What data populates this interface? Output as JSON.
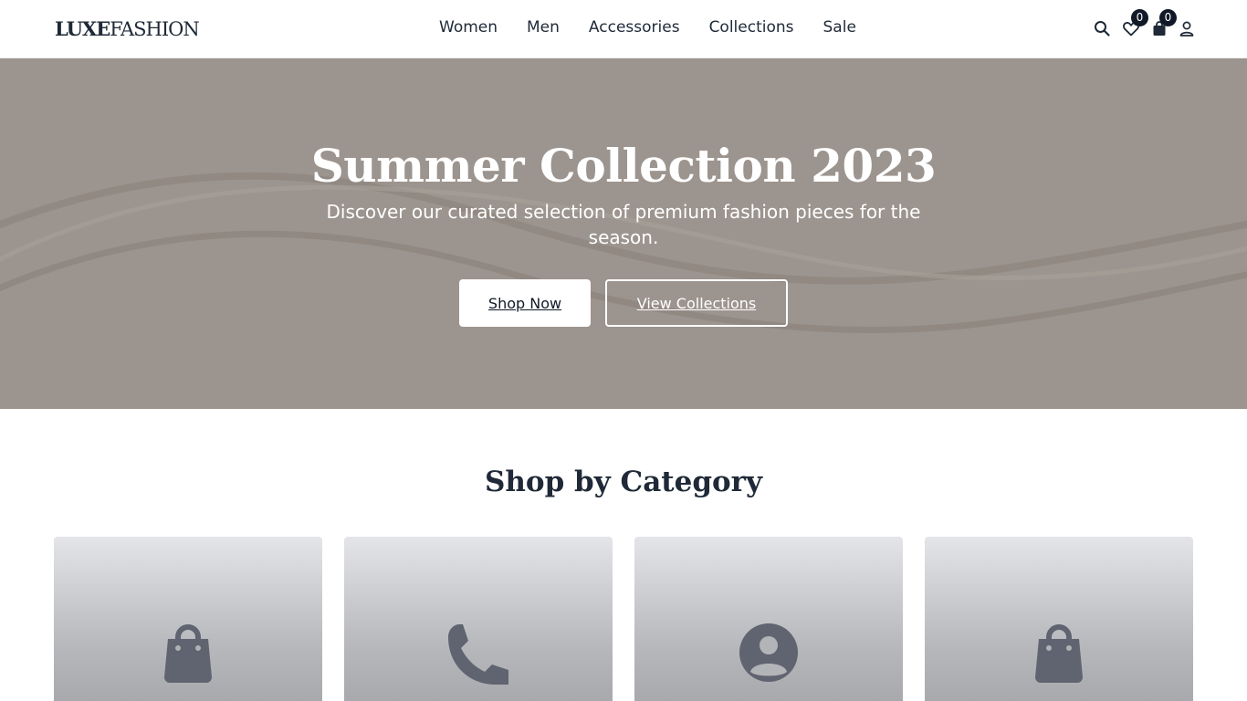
{
  "header": {
    "logo_part1": "LUXE",
    "logo_part2": "FASHION",
    "nav": [
      "Women",
      "Men",
      "Accessories",
      "Collections",
      "Sale"
    ],
    "icons": {
      "search": "search-icon",
      "wishlist": "heart-icon",
      "cart": "shopping-bag-icon",
      "account": "user-icon"
    },
    "wishlist_count": "0",
    "cart_count": "0"
  },
  "hero": {
    "title": "Summer Collection 2023",
    "subtitle": "Discover our curated selection of premium fashion pieces for the season.",
    "primary_button": "Shop Now",
    "secondary_button": "View Collections",
    "background_color": "#9c948e"
  },
  "categories": {
    "title": "Shop by Category",
    "cards": [
      {
        "icon": "shopping-bag-icon"
      },
      {
        "icon": "phone-icon"
      },
      {
        "icon": "user-circle-icon"
      },
      {
        "icon": "shopping-bag-icon"
      }
    ]
  },
  "colors": {
    "text_dark": "#1f2937",
    "badge": "#111827",
    "icon_gray": "#5f6470"
  }
}
